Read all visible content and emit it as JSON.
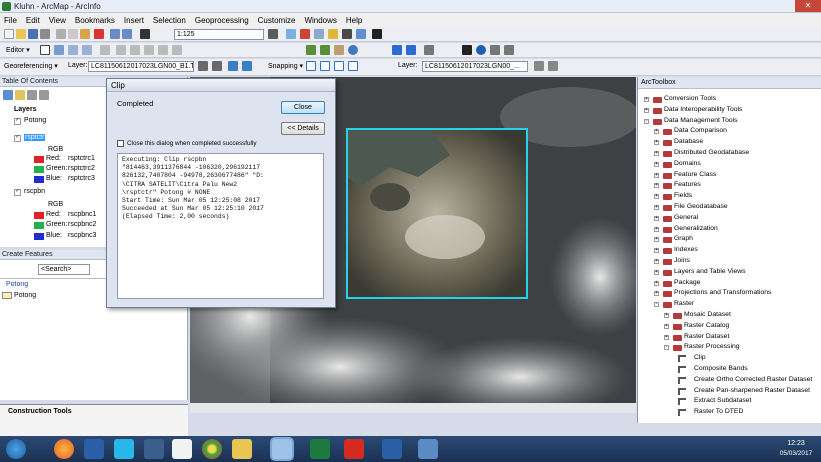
{
  "window": {
    "title": "Kluhn - ArcMap - ArcInfo"
  },
  "menu": [
    "File",
    "Edit",
    "View",
    "Bookmarks",
    "Insert",
    "Selection",
    "Geoprocessing",
    "Customize",
    "Windows",
    "Help"
  ],
  "toolbar1": {
    "scale": "1:125"
  },
  "toolbar2": {
    "editor": "Editor ▾"
  },
  "toolbar3": {
    "georef": "Georeferencing ▾",
    "layer_label": "Layer:",
    "layer_value": "LC81150612017023LGN00_B1.TIF",
    "snapping": "Snapping ▾",
    "layer2_label": "Layer:",
    "layer2_value": "LC81150612017023LGN00_..."
  },
  "toc": {
    "title": "Table Of Contents",
    "root": "Layers",
    "items": [
      {
        "name": "Potong"
      },
      {
        "name": "rsptctr",
        "selected": true
      },
      {
        "name": "RGB"
      },
      {
        "name": "Red:",
        "band": "rsptctrc1",
        "color": "#e0232a"
      },
      {
        "name": "Green:",
        "band": "rsptctrc2",
        "color": "#23b14d"
      },
      {
        "name": "Blue:",
        "band": "rsptctrc3",
        "color": "#1f2dcf"
      },
      {
        "name": "rscpbn"
      },
      {
        "name": "RGB"
      },
      {
        "name": "Red:",
        "band": "rscpbnc1",
        "color": "#e0232a"
      },
      {
        "name": "Green:",
        "band": "rscpbnc2",
        "color": "#23b14d"
      },
      {
        "name": "Blue:",
        "band": "rscpbnc3",
        "color": "#1f2dcf"
      }
    ]
  },
  "create_features": {
    "title": "Create Features",
    "search": "<Search>",
    "group": "Potong",
    "item": "Potong"
  },
  "construction_tools": {
    "title": "Construction Tools"
  },
  "clip_dialog": {
    "title": "Clip",
    "status": "Completed",
    "close_btn": "Close",
    "details_btn": "<< Details",
    "checkbox_label": "Close this dialog when completed successfully",
    "log": "Executing: Clip rscpbn\n\"814463,3911376844 -106320,296192117\n826132,7407804 -94978,2630677486\" \"D:\n\\CITRA SATELIT\\Citra Palu New2\n\\rsptctr\" Potong # NONE\nStart Time: Sun Mar 05 12:25:08 2017\nSucceeded at Sun Mar 05 12:25:10 2017\n(Elapsed Time: 2,00 seconds)"
  },
  "toolbox": {
    "title": "ArcToolbox",
    "items": [
      {
        "label": "Conversion Tools",
        "level": 0,
        "exp": "+"
      },
      {
        "label": "Data Interoperability Tools",
        "level": 0,
        "exp": "+"
      },
      {
        "label": "Data Management Tools",
        "level": 0,
        "exp": "-"
      },
      {
        "label": "Data Comparison",
        "level": 1,
        "exp": "+"
      },
      {
        "label": "Database",
        "level": 1,
        "exp": "+"
      },
      {
        "label": "Distributed Geodatabase",
        "level": 1,
        "exp": "+"
      },
      {
        "label": "Domains",
        "level": 1,
        "exp": "+"
      },
      {
        "label": "Feature Class",
        "level": 1,
        "exp": "+"
      },
      {
        "label": "Features",
        "level": 1,
        "exp": "+"
      },
      {
        "label": "Fields",
        "level": 1,
        "exp": "+"
      },
      {
        "label": "File Geodatabase",
        "level": 1,
        "exp": "+"
      },
      {
        "label": "General",
        "level": 1,
        "exp": "+"
      },
      {
        "label": "Generalization",
        "level": 1,
        "exp": "+"
      },
      {
        "label": "Graph",
        "level": 1,
        "exp": "+"
      },
      {
        "label": "Indexes",
        "level": 1,
        "exp": "+"
      },
      {
        "label": "Joins",
        "level": 1,
        "exp": "+"
      },
      {
        "label": "Layers and Table Views",
        "level": 1,
        "exp": "+"
      },
      {
        "label": "Package",
        "level": 1,
        "exp": "+"
      },
      {
        "label": "Projections and Transformations",
        "level": 1,
        "exp": "+"
      },
      {
        "label": "Raster",
        "level": 1,
        "exp": "-"
      },
      {
        "label": "Mosaic Dataset",
        "level": 2,
        "exp": "+"
      },
      {
        "label": "Raster Catalog",
        "level": 2,
        "exp": "+"
      },
      {
        "label": "Raster Dataset",
        "level": 2,
        "exp": "+"
      },
      {
        "label": "Raster Processing",
        "level": 2,
        "exp": "-"
      },
      {
        "label": "Clip",
        "level": 3,
        "exp": ""
      },
      {
        "label": "Composite Bands",
        "level": 3,
        "exp": ""
      },
      {
        "label": "Create Ortho Corrected Raster Dataset",
        "level": 3,
        "exp": ""
      },
      {
        "label": "Create Pan-sharpened Raster Dataset",
        "level": 3,
        "exp": ""
      },
      {
        "label": "Extract Subdataset",
        "level": 3,
        "exp": ""
      },
      {
        "label": "Raster To DTED",
        "level": 3,
        "exp": ""
      }
    ]
  },
  "clock": {
    "time": "12:23",
    "date": "05/03/2017"
  }
}
